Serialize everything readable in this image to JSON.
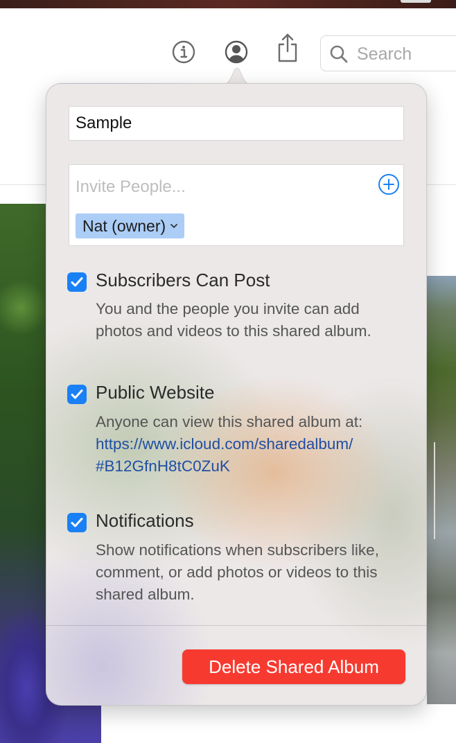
{
  "toolbar": {
    "info_icon": "info-icon",
    "people_icon": "person-circle-icon",
    "share_icon": "share-icon",
    "search": {
      "placeholder": "Search"
    }
  },
  "popover": {
    "album_name": "Sample",
    "invite": {
      "placeholder": "Invite People...",
      "add_icon": "plus-circle-icon",
      "owner_token": "Nat (owner)"
    },
    "options": [
      {
        "checked": true,
        "title": "Subscribers Can Post",
        "description": "You and the people you invite can add photos and videos to this shared album."
      },
      {
        "checked": true,
        "title": "Public Website",
        "description": "Anyone can view this shared album at:",
        "link_line1": "https://www.icloud.com/sharedalbum/",
        "link_line2": "#B12GfnH8tC0ZuK"
      },
      {
        "checked": true,
        "title": "Notifications",
        "description": "Show notifications when subscribers like, comment, or add photos or videos to this shared album."
      }
    ],
    "delete_label": "Delete Shared Album"
  },
  "colors": {
    "accent": "#1a80f5",
    "destructive": "#f73a30",
    "link": "#1f4ea3"
  }
}
